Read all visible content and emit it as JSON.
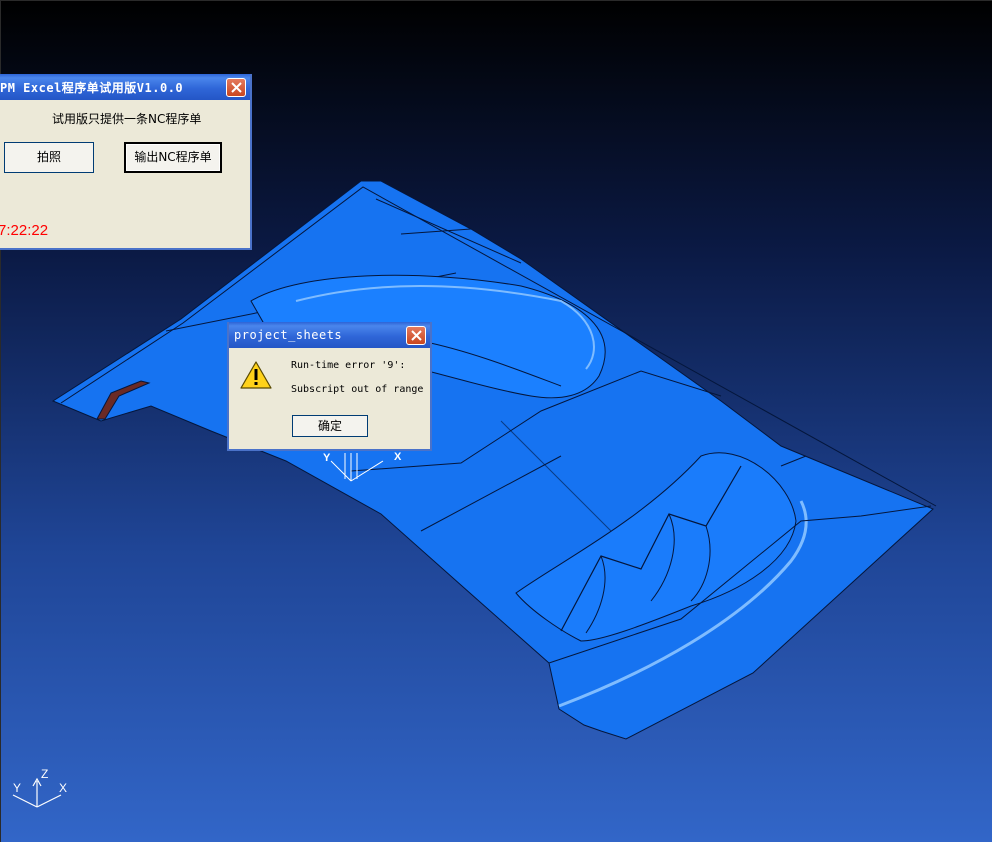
{
  "viewport": {
    "axis_labels": {
      "z": "Z",
      "y": "Y",
      "x": "X"
    },
    "model_axis_labels": {
      "y": "Y",
      "x": "X"
    },
    "colors": {
      "model": "#1673f1",
      "model_edge": "#04163c",
      "background_top": "#000000",
      "background_bottom": "#3266c8"
    }
  },
  "main_window": {
    "title": "PM Excel程序单试用版V1.0.0",
    "message": "试用版只提供一条NC程序单",
    "buttons": {
      "snapshot": "拍照",
      "export": "输出NC程序单"
    },
    "time": "7:22:22",
    "time_color": "#ff0000"
  },
  "error_dialog": {
    "title": "project_sheets",
    "icon": "warning-icon",
    "line1": "Run-time error '9':",
    "line2": "Subscript out of range",
    "ok_label": "确定"
  }
}
